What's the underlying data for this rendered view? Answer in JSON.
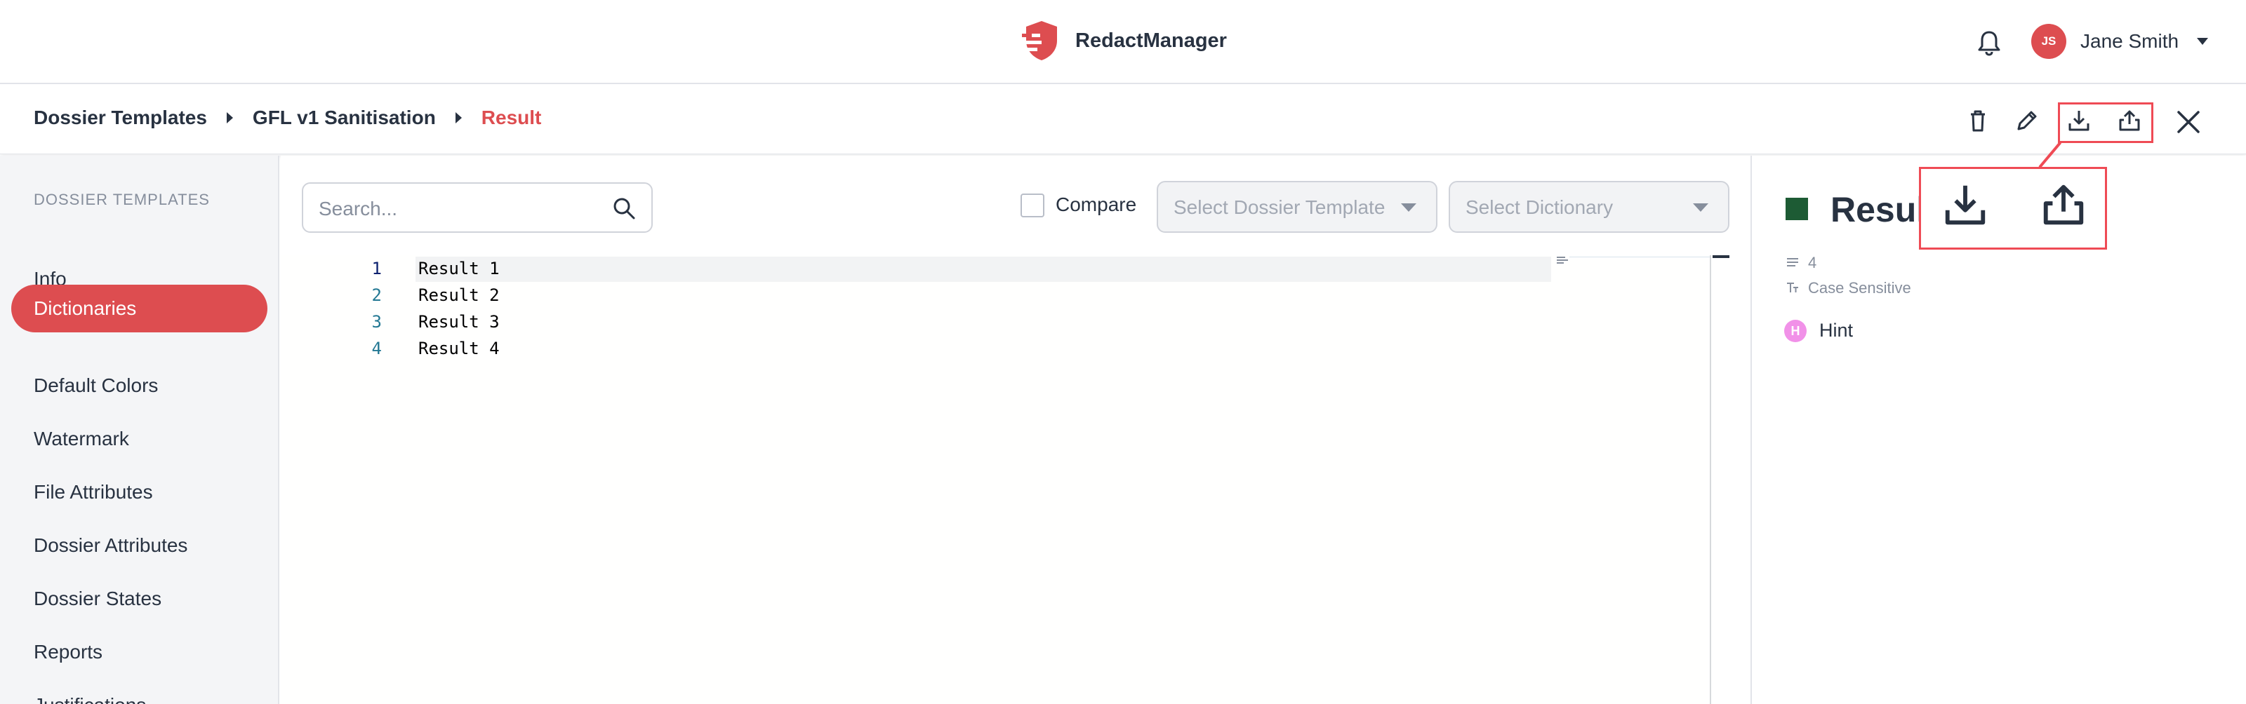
{
  "header": {
    "app_name": "RedactManager",
    "user": {
      "initials": "JS",
      "name": "Jane Smith"
    },
    "icons": {
      "logo": "redactmanager-logo-icon",
      "notifications": "bell-icon",
      "user_menu": "chevron-down-icon"
    },
    "colors": {
      "brand": "#dd4d50",
      "text": "#283241"
    }
  },
  "breadcrumb": {
    "items": [
      "Dossier Templates",
      "GFL v1 Sanitisation",
      "Result"
    ]
  },
  "toolbar": {
    "icons": [
      "trash-icon",
      "edit-pencil-icon",
      "download-icon",
      "upload-share-icon",
      "close-icon"
    ]
  },
  "sidebar": {
    "title": "DOSSIER TEMPLATES",
    "items": [
      {
        "label": "Info",
        "active": false
      },
      {
        "label": "Dictionaries",
        "active": true
      },
      {
        "label": "Default Colors",
        "active": false
      },
      {
        "label": "Watermark",
        "active": false
      },
      {
        "label": "File Attributes",
        "active": false
      },
      {
        "label": "Dossier Attributes",
        "active": false
      },
      {
        "label": "Dossier States",
        "active": false
      },
      {
        "label": "Reports",
        "active": false
      },
      {
        "label": "Justifications",
        "active": false
      }
    ]
  },
  "editor": {
    "search_placeholder": "Search...",
    "compare_label": "Compare",
    "compare_checked": false,
    "select_template_placeholder": "Select Dossier Template",
    "select_dictionary_placeholder": "Select Dictionary",
    "line_numbers": [
      "1",
      "2",
      "3",
      "4"
    ],
    "lines": [
      "Result 1",
      "Result 2",
      "Result 3",
      "Result 4"
    ]
  },
  "details": {
    "title": "Resul",
    "swatch_color": "#1d5b34",
    "entries_count": "4",
    "case_label": "Case Sensitive",
    "type_badge": "H",
    "type_badge_color": "#f191e8",
    "type_label": "Hint"
  },
  "highlight": {
    "color": "#ef4b55",
    "icons": [
      "download-icon",
      "upload-share-icon"
    ]
  }
}
